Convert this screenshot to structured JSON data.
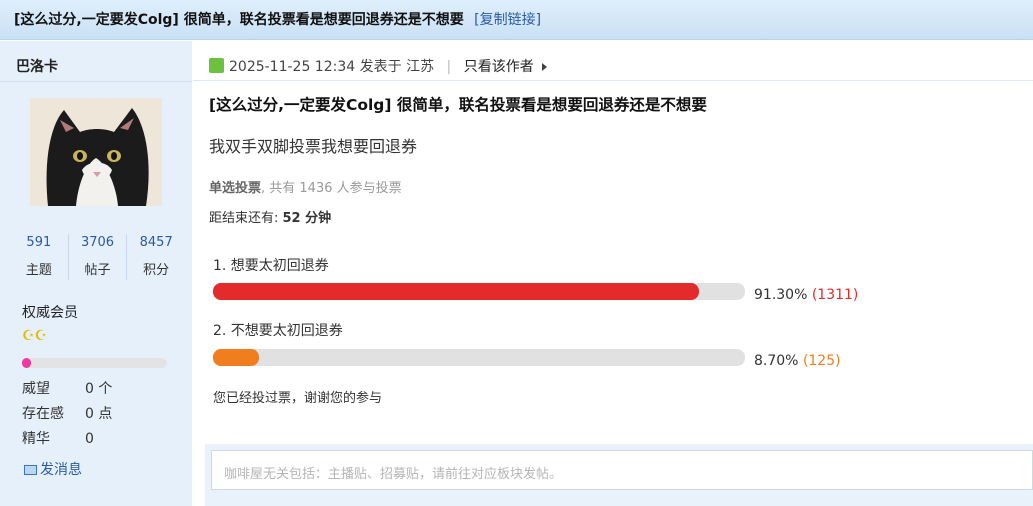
{
  "thread": {
    "title": "[这么过分,一定要发Colg] 很简单，联名投票看是想要回退券还是不想要",
    "copy_link": "[复制链接]"
  },
  "user": {
    "name": "巴洛卡",
    "stats": [
      {
        "num": "591",
        "label": "主题"
      },
      {
        "num": "3706",
        "label": "帖子"
      },
      {
        "num": "8457",
        "label": "积分"
      }
    ],
    "rank": "权威会员",
    "rank_icons": "☪☪",
    "level_progress": 0.06,
    "props": [
      {
        "key": "威望",
        "value": "0 个"
      },
      {
        "key": "存在感",
        "value": "0 点"
      },
      {
        "key": "精华",
        "value": "0"
      }
    ],
    "send_message": "发消息"
  },
  "post": {
    "date": "2025-11-25 12:34",
    "posted_in": "发表于 江苏",
    "only_author": "只看该作者",
    "title": "[这么过分,一定要发Colg] 很简单，联名投票看是想要回退券还是不想要",
    "body": "我双手双脚投票我想要回退券"
  },
  "poll": {
    "type": "单选投票",
    "summary": ", 共有 1436 人参与投票",
    "deadline_label": "距结束还有: ",
    "deadline_value": "52 分钟",
    "options": [
      {
        "label": "1.  想要太初回退券",
        "percent": 91.3,
        "percent_text": "91.30%",
        "count_text": "(1311)",
        "color": "#e42b2b"
      },
      {
        "label": "2.  不想要太初回退券",
        "percent": 8.7,
        "percent_text": "8.70%",
        "count_text": "(125)",
        "color": "#f07d1e"
      }
    ],
    "voted_note": "您已经投过票，谢谢您的参与"
  },
  "reply": {
    "placeholder": "咖啡屋无关包括：主播贴、招募贴，请前往对应板块发帖。"
  },
  "colors": {
    "link": "#2b5aa5",
    "sidebar_bg": "#e6f0fa",
    "title_bar_bg": "#cfe4f6"
  }
}
